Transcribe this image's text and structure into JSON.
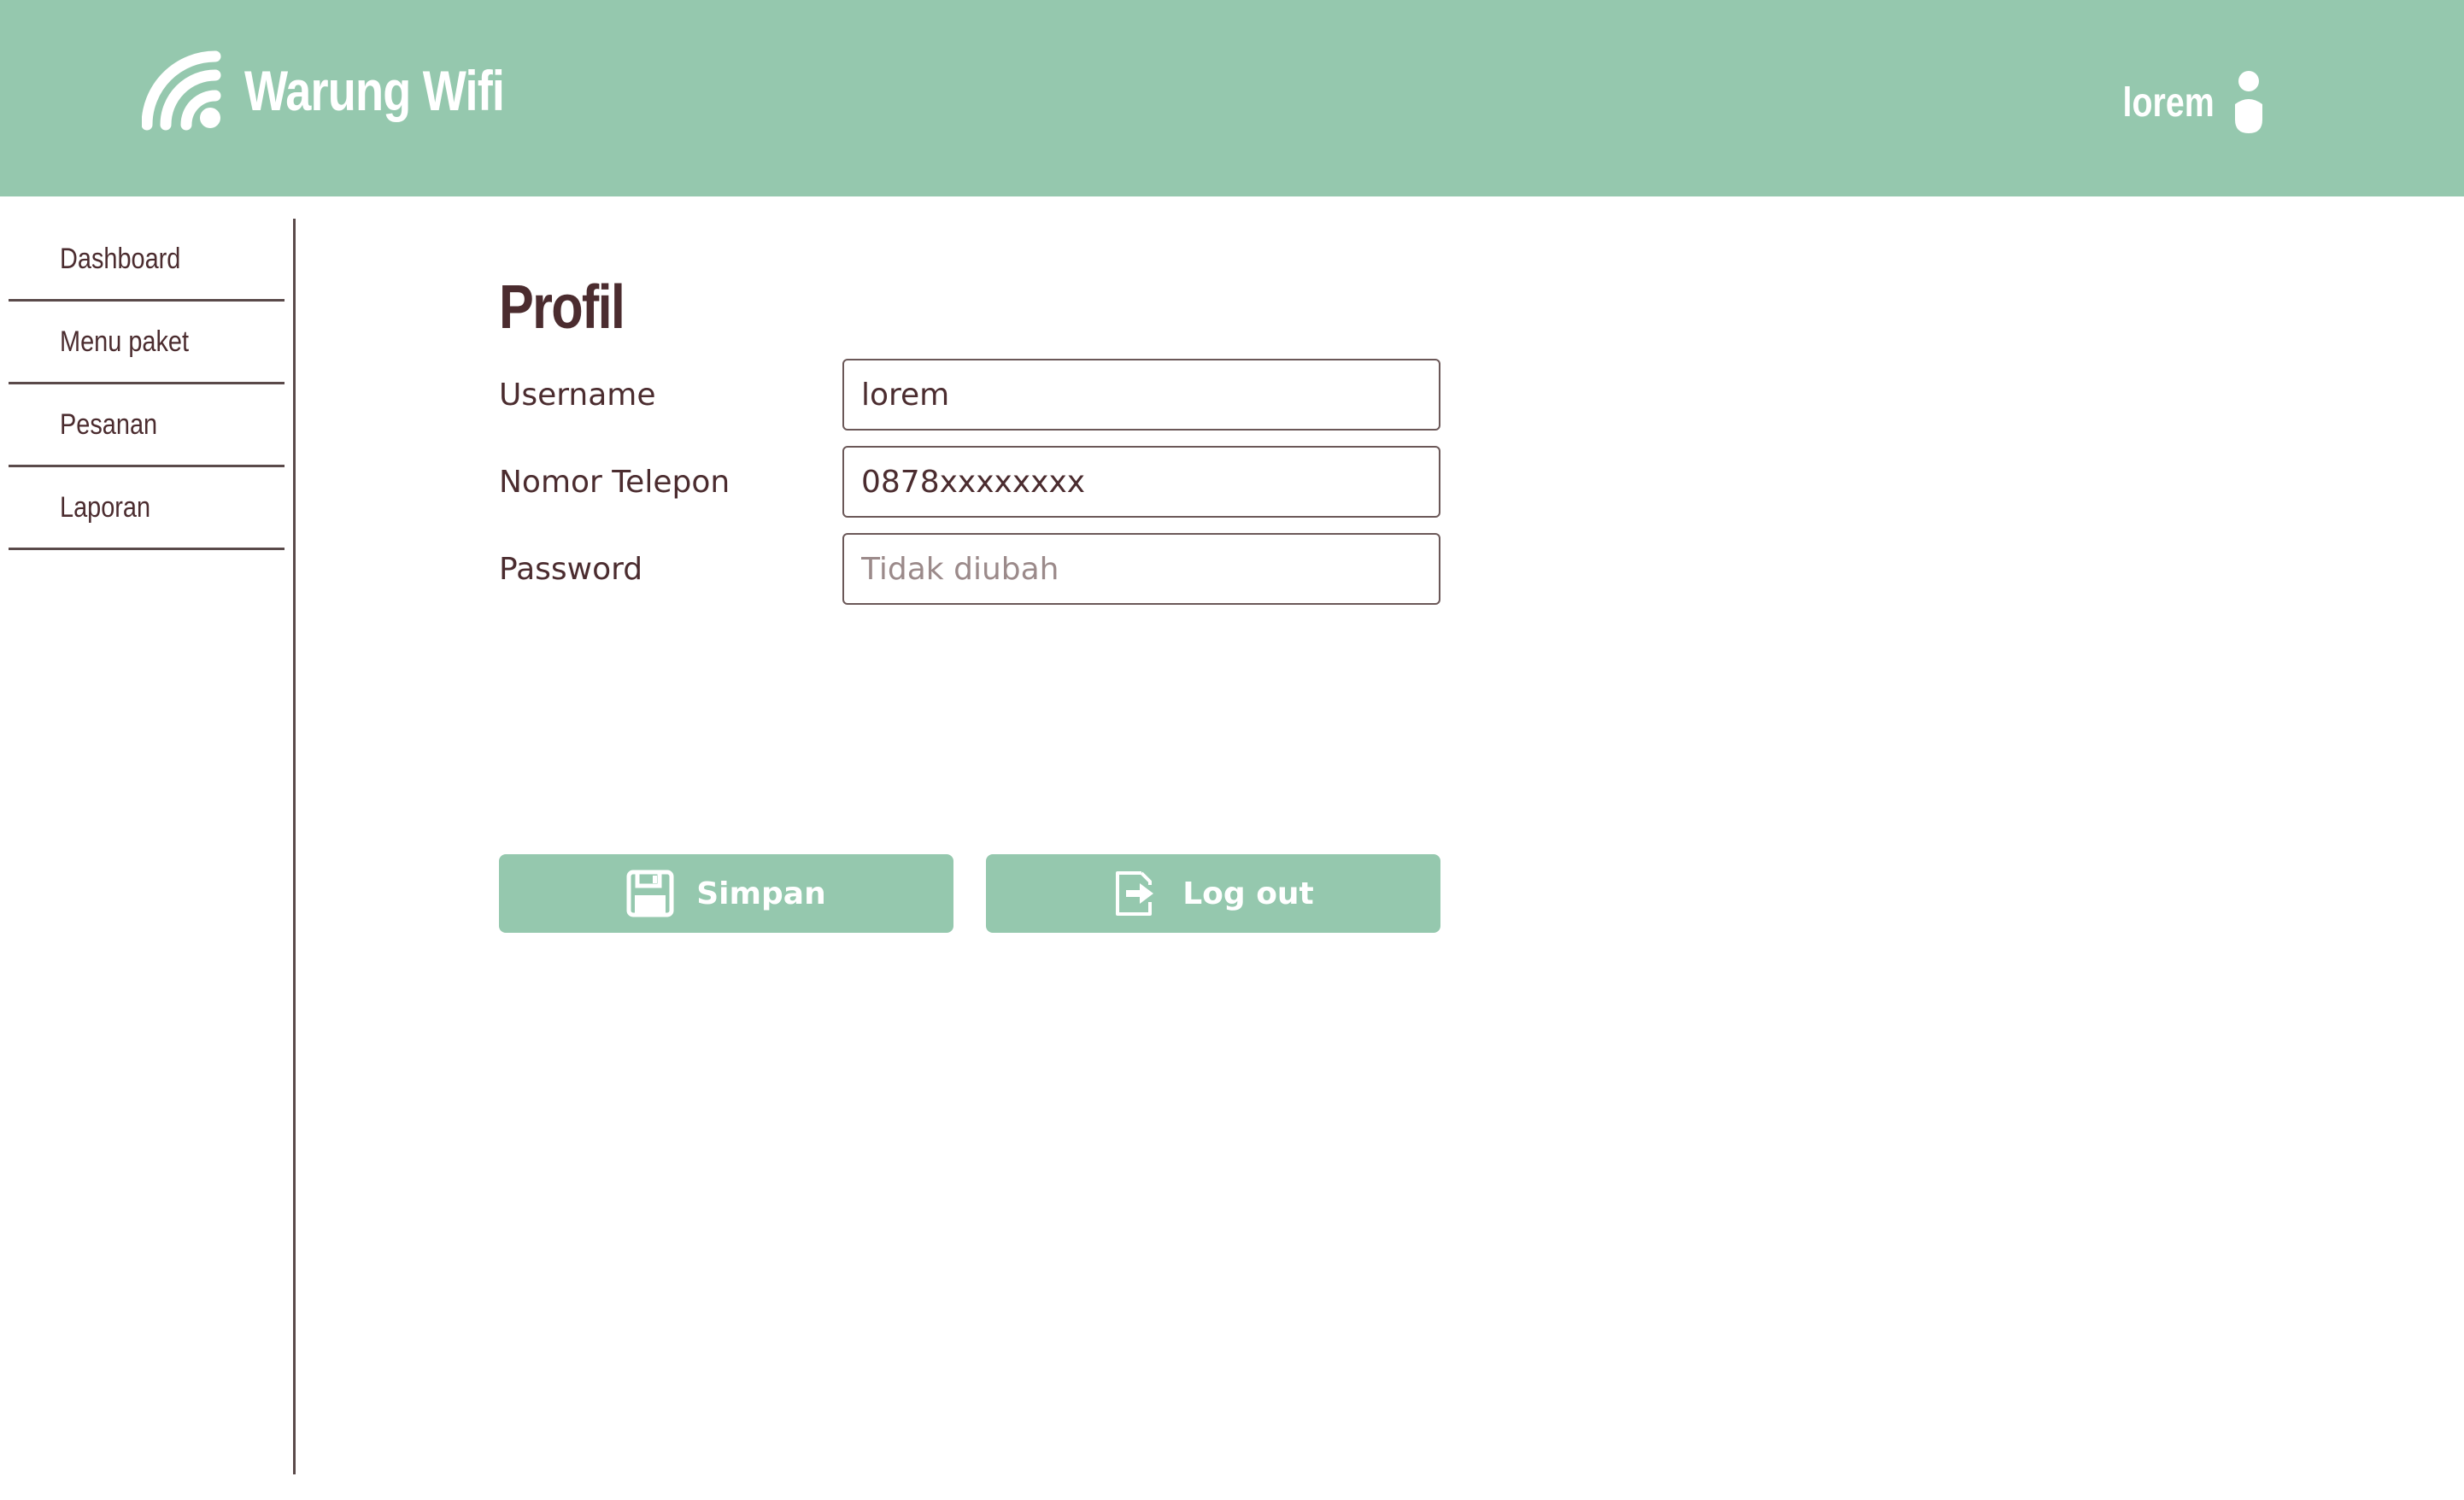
{
  "header": {
    "brand_name": "Warung Wifi",
    "brand_icon": "wifi-icon",
    "user_name": "lorem",
    "user_icon": "user-icon",
    "background_color": "#95c8ae"
  },
  "sidebar": {
    "items": [
      {
        "label": "Dashboard"
      },
      {
        "label": "Menu paket"
      },
      {
        "label": "Pesanan"
      },
      {
        "label": "Laporan"
      }
    ]
  },
  "profile": {
    "title": "Profil",
    "fields": [
      {
        "label": "Username",
        "value": "lorem",
        "placeholder": ""
      },
      {
        "label": "Nomor Telepon",
        "value": "0878xxxxxxxx",
        "placeholder": ""
      },
      {
        "label": "Password",
        "value": "",
        "placeholder": "Tidak diubah"
      }
    ]
  },
  "actions": {
    "save_label": "Simpan",
    "save_icon": "floppy-disk-icon",
    "logout_label": "Log out",
    "logout_icon": "sign-out-icon"
  },
  "colors": {
    "accent": "#95c8ae",
    "text": "#4b2c2f",
    "border": "#5a4a4a"
  }
}
